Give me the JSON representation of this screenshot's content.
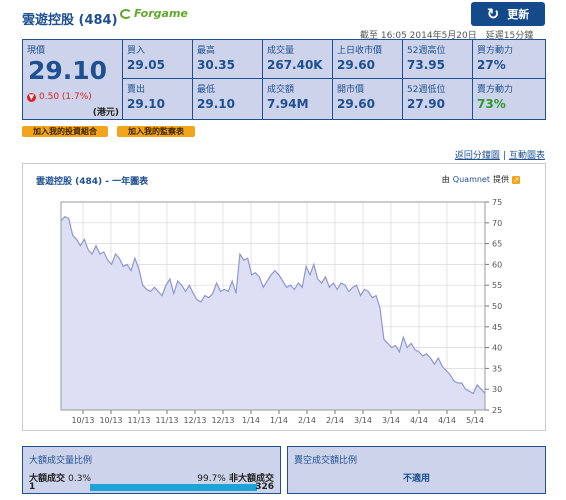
{
  "header": {
    "title": "雲遊控股 (484)",
    "brand": "Forgame",
    "refresh_label": "更新",
    "as_of": "截至 16:05 2014年5月20日　延遲15分鐘"
  },
  "quote": {
    "main": {
      "label": "現價",
      "price": "29.10",
      "change": "0.50 (1.7%)",
      "unit": "(港元)"
    },
    "cells": [
      {
        "label": "買入",
        "value": "29.05"
      },
      {
        "label": "最高",
        "value": "30.35"
      },
      {
        "label": "成交量",
        "value": "267.40K"
      },
      {
        "label": "上日收市價",
        "value": "29.60"
      },
      {
        "label": "52週高位",
        "value": "73.95"
      },
      {
        "label": "買方動力",
        "value": "27%"
      },
      {
        "label": "賣出",
        "value": "29.10"
      },
      {
        "label": "最低",
        "value": "29.10"
      },
      {
        "label": "成交額",
        "value": "7.94M"
      },
      {
        "label": "開市價",
        "value": "29.60"
      },
      {
        "label": "52週低位",
        "value": "27.90"
      },
      {
        "label": "賣方動力",
        "value": "73%"
      }
    ]
  },
  "buttons": {
    "add_portfolio": "加入我的投資組合",
    "add_watchlist": "加入我的監察表"
  },
  "links": {
    "intraday": "返回分鐘圖",
    "interactive": "互動圖表"
  },
  "chart_panel": {
    "title": "雲遊控股 (484) - 一年圖表",
    "source_prefix": "由",
    "source_name": "Quamnet",
    "source_suffix": "提供"
  },
  "colors": {
    "accent": "#1d4f91",
    "panel_bg": "#ccd3ea",
    "chart_fill": "#dde0f5",
    "chart_line": "#8f96cf",
    "orange": "#f2a51a",
    "down": "#dd2222",
    "green": "#2a9a2a"
  },
  "chart_data": {
    "type": "area",
    "title": "雲遊控股 (484) - 一年圖表",
    "xlabel": "",
    "ylabel": "",
    "ylim": [
      25,
      75
    ],
    "yticks": [
      25,
      30,
      35,
      40,
      45,
      50,
      55,
      60,
      65,
      70,
      75
    ],
    "xticks": [
      "10/13",
      "10/13",
      "11/13",
      "11/13",
      "12/13",
      "12/13",
      "1/14",
      "1/14",
      "2/14",
      "2/14",
      "3/14",
      "3/14",
      "4/14",
      "4/14",
      "5/14"
    ],
    "grid": true,
    "series": [
      {
        "values": [
          70.5,
          71.5,
          71.0,
          67.0,
          66.0,
          64.5,
          66.0,
          63.5,
          62.5,
          64.5,
          62.5,
          63.0,
          61.0,
          60.0,
          62.5,
          61.5,
          59.5,
          60.0,
          58.5,
          61.5,
          59.0,
          55.0,
          54.0,
          53.5,
          54.5,
          53.5,
          52.5,
          55.0,
          56.5,
          53.0,
          56.0,
          55.0,
          53.5,
          55.0,
          53.0,
          51.5,
          51.0,
          52.5,
          52.0,
          53.0,
          55.5,
          53.5,
          54.0,
          53.5,
          56.0,
          53.0,
          62.5,
          61.0,
          61.5,
          57.5,
          58.0,
          57.0,
          54.5,
          56.0,
          57.5,
          58.5,
          57.5,
          56.0,
          54.5,
          55.0,
          54.0,
          55.5,
          54.5,
          59.5,
          57.5,
          60.0,
          56.5,
          55.5,
          57.0,
          54.5,
          55.5,
          54.0,
          55.5,
          55.0,
          53.5,
          54.5,
          55.0,
          52.5,
          54.0,
          53.5,
          52.0,
          52.5,
          49.5,
          42.0,
          41.0,
          40.0,
          40.5,
          39.0,
          42.5,
          40.0,
          41.0,
          39.5,
          39.0,
          38.0,
          38.5,
          37.5,
          36.0,
          37.5,
          35.5,
          34.5,
          33.5,
          32.0,
          31.5,
          31.5,
          30.0,
          29.5,
          29.0,
          31.0,
          30.0,
          29.0
        ]
      }
    ]
  }
}
